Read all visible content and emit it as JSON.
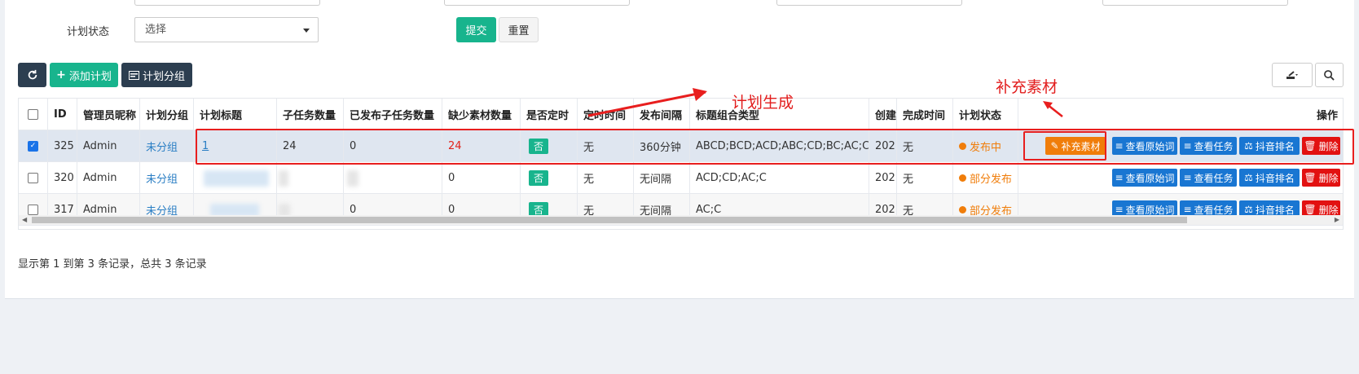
{
  "form": {
    "plan_status_label": "计划状态",
    "plan_status_select": "选择",
    "submit_label": "提交",
    "reset_label": "重置"
  },
  "toolbar": {
    "add_plan_label": "添加计划",
    "plan_group_label": "计划分组"
  },
  "table": {
    "headers": {
      "id": "ID",
      "admin_nick": "管理员昵称",
      "plan_group": "计划分组",
      "plan_title": "计划标题",
      "subtask_count": "子任务数量",
      "published_subtask_count": "已发布子任务数量",
      "missing_material_count": "缺少素材数量",
      "is_scheduled": "是否定时",
      "schedule_time": "定时时间",
      "publish_interval": "发布间隔",
      "title_combo_type": "标题组合类型",
      "created_col": "创建",
      "finish_time": "完成时间",
      "plan_status": "计划状态",
      "actions": "操作"
    },
    "rows": [
      {
        "id": "325",
        "admin": "Admin",
        "group": "未分组",
        "title": "1",
        "subtask_count": "24",
        "published": "0",
        "missing": "24",
        "scheduled": "否",
        "schedule_time": "无",
        "interval": "360分钟",
        "combo": "ABCD;BCD;ACD;ABC;CD;BC;AC;C",
        "created": "202",
        "finish": "无",
        "status": "发布中"
      },
      {
        "id": "320",
        "admin": "Admin",
        "group": "未分组",
        "title": "",
        "subtask_count": "",
        "published": "",
        "missing": "0",
        "scheduled": "否",
        "schedule_time": "无",
        "interval": "无间隔",
        "combo": "ACD;CD;AC;C",
        "created": "202",
        "finish": "无",
        "status": "部分发布"
      },
      {
        "id": "317",
        "admin": "Admin",
        "group": "未分组",
        "title": "",
        "subtask_count": "",
        "published": "0",
        "missing": "0",
        "scheduled": "否",
        "schedule_time": "无",
        "interval": "无间隔",
        "combo": "AC;C",
        "created": "202",
        "finish": "无",
        "status": "部分发布"
      }
    ],
    "actions": {
      "supplement": "补充素材",
      "view_keywords": "查看原始词",
      "view_tasks": "查看任务",
      "douyin_rank": "抖音排名",
      "delete": "删除"
    }
  },
  "pagination": {
    "summary": "显示第 1 到第 3 条记录，总共 3 条记录"
  },
  "annotations": {
    "plan_generate": "计划生成",
    "supplement_material": "补充素材"
  },
  "colors": {
    "green": "#18b48d",
    "dark": "#2c3e50",
    "blue": "#1976d2",
    "red": "#e21111",
    "orange": "#f07d0a",
    "annotation_red": "#e81e1e"
  },
  "icons": [
    "refresh-icon",
    "plus-icon",
    "card-icon",
    "export-icon",
    "search-icon",
    "pencil-icon",
    "list-icon",
    "balance-icon",
    "trash-icon"
  ]
}
